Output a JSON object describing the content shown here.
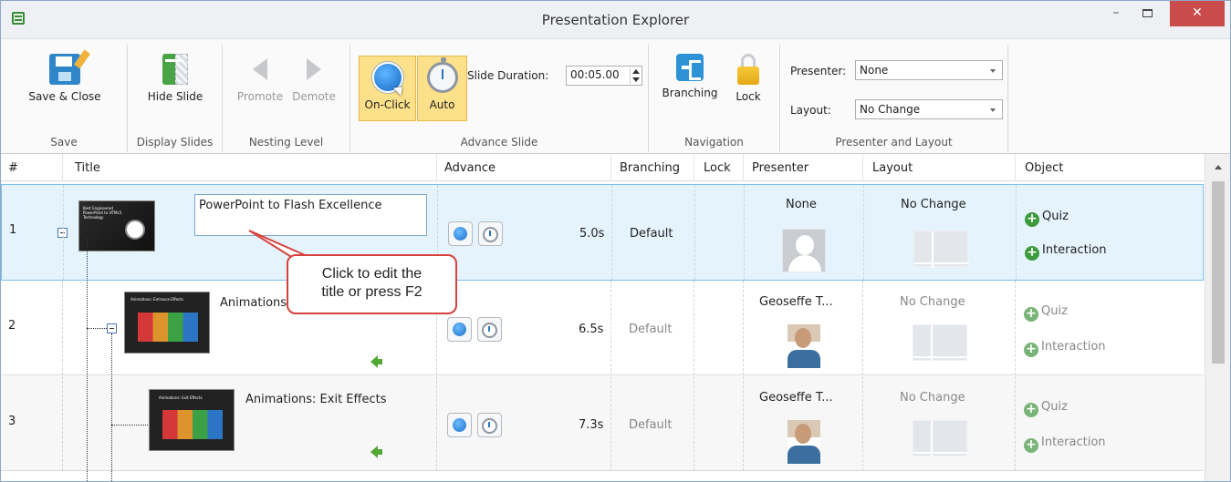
{
  "window": {
    "title": "Presentation Explorer",
    "minimize": "–",
    "close": "✕"
  },
  "ribbon": {
    "save_close": "Save & Close",
    "hide_slide": "Hide Slide",
    "promote": "Promote",
    "demote": "Demote",
    "on_click": "On-Click",
    "auto": "Auto",
    "slide_duration_label": "Slide Duration:",
    "slide_duration_value": "00:05.00",
    "branching": "Branching",
    "lock": "Lock",
    "presenter_label": "Presenter:",
    "presenter_value": "None",
    "layout_label": "Layout:",
    "layout_value": "No Change",
    "groups": {
      "save": "Save",
      "display_slides": "Display Slides",
      "nesting_level": "Nesting Level",
      "advance_slide": "Advance Slide",
      "navigation": "Navigation",
      "presenter_and_layout": "Presenter and Layout"
    }
  },
  "grid": {
    "headers": {
      "num": "#",
      "title": "Title",
      "advance": "Advance",
      "branching": "Branching",
      "lock": "Lock",
      "presenter": "Presenter",
      "layout": "Layout",
      "object": "Object"
    },
    "rows": [
      {
        "num": "1",
        "title": "PowerPoint to Flash Excellence",
        "duration": "5.0s",
        "branching": "Default",
        "presenter": "None",
        "layout": "No Change",
        "obj1": "Quiz",
        "obj2": "Interaction",
        "thumb": "Best Engineered PowerPoint to HTML5 Technology"
      },
      {
        "num": "2",
        "title": "Animations",
        "duration": "6.5s",
        "branching": "Default",
        "presenter": "Geoseffe T...",
        "layout": "No Change",
        "obj1": "Quiz",
        "obj2": "Interaction",
        "thumb": "Animations: Entrance Effects"
      },
      {
        "num": "3",
        "title": "Animations: Exit Effects",
        "duration": "7.3s",
        "branching": "Default",
        "presenter": "Geoseffe T...",
        "layout": "No Change",
        "obj1": "Quiz",
        "obj2": "Interaction",
        "thumb": "Animations: Exit Effects"
      }
    ]
  },
  "callout": {
    "line1": "Click to edit the",
    "line2": "title or press F2"
  },
  "colors": {
    "accent": "#2f86c8",
    "selected_row": "#e5f3fc",
    "toggle_active": "#fce08a",
    "callout_border": "#d7423e",
    "close_button": "#c94b4b"
  }
}
